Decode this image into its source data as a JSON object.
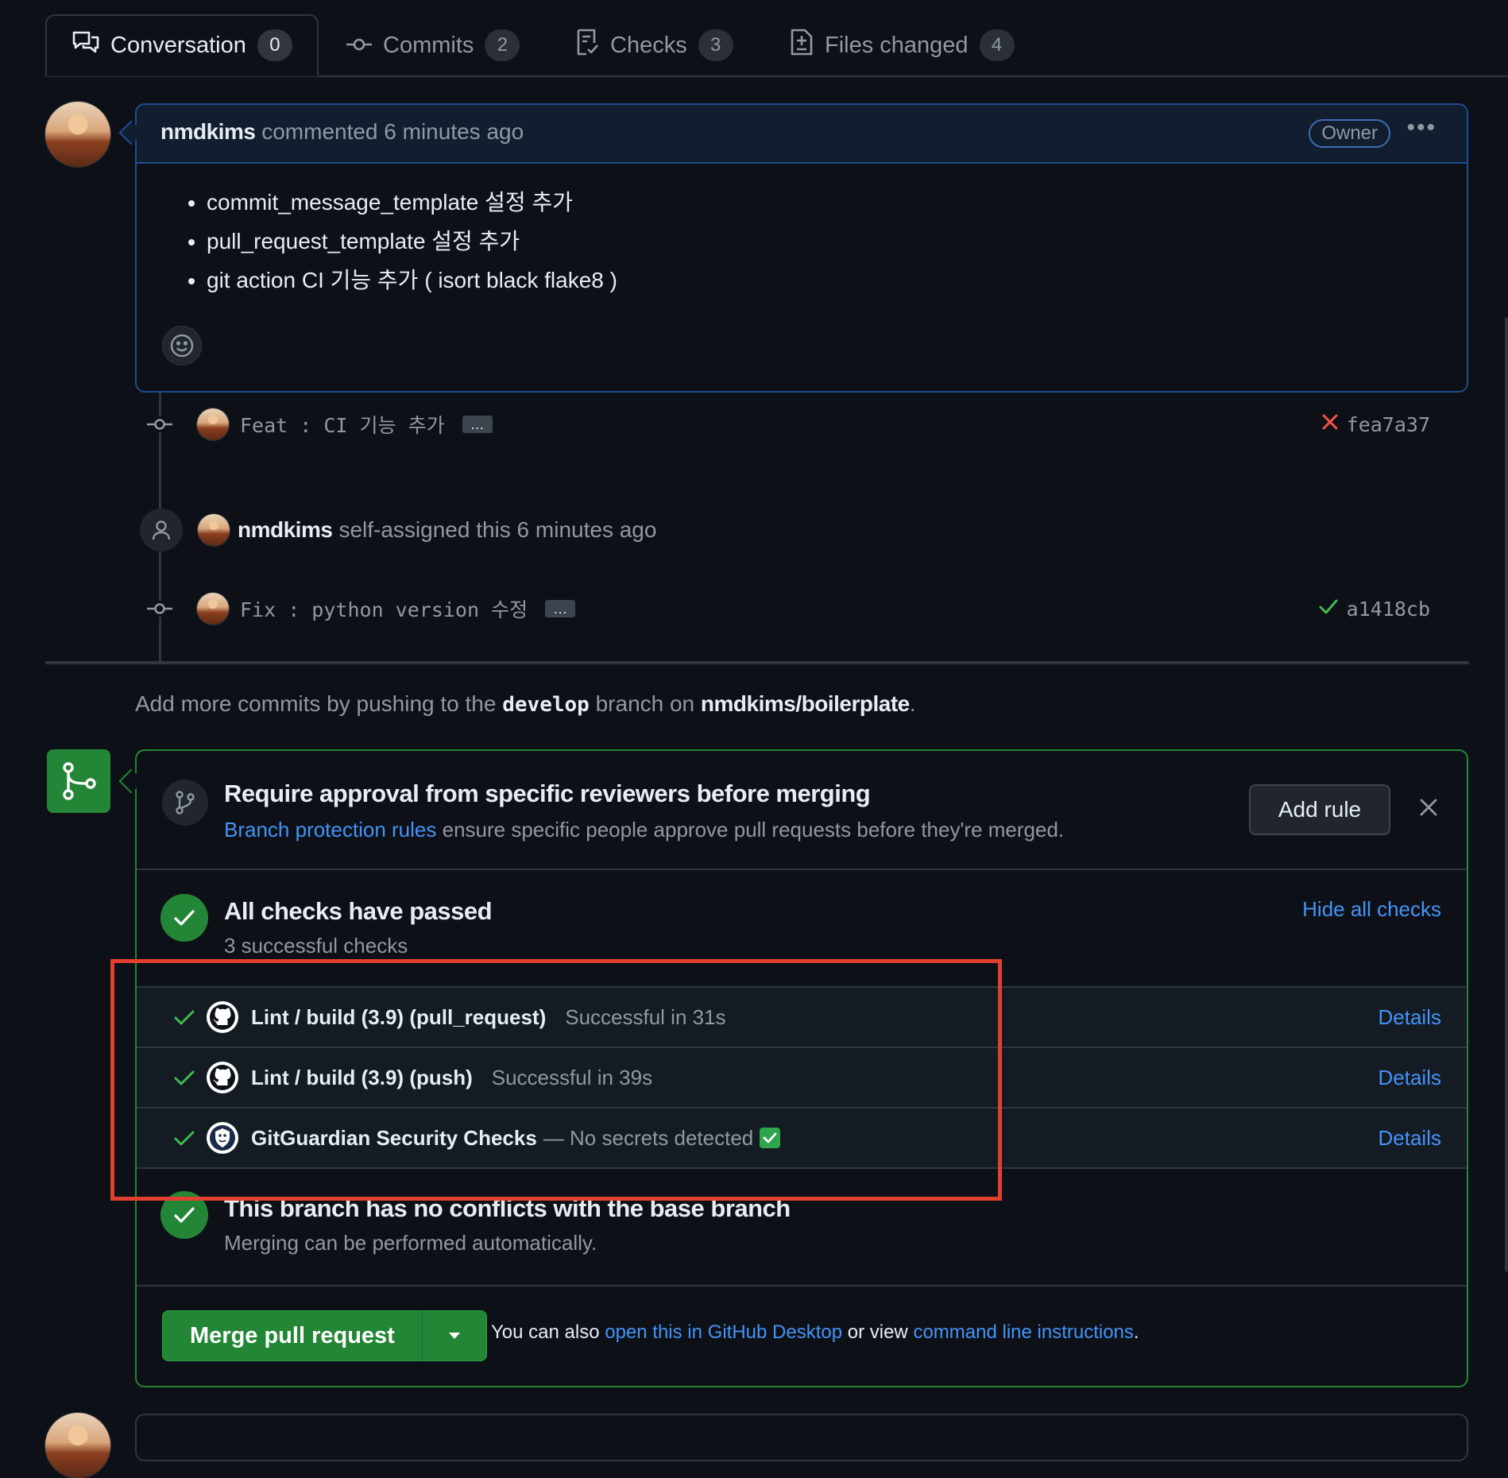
{
  "tabs": [
    {
      "label": "Conversation",
      "count": "0",
      "icon": "comment-discussion-icon"
    },
    {
      "label": "Commits",
      "count": "2",
      "icon": "git-commit-icon"
    },
    {
      "label": "Checks",
      "count": "3",
      "icon": "checklist-icon"
    },
    {
      "label": "Files changed",
      "count": "4",
      "icon": "file-diff-icon"
    }
  ],
  "comment": {
    "author": "nmdkims",
    "action": "commented 6 minutes ago",
    "badge": "Owner",
    "more_icon": "kebab-horizontal-icon",
    "items": [
      "commit_message_template 설정 추가",
      "pull_request_template 설정 추가",
      "git action CI 기능 추가 ( isort black flake8 )"
    ],
    "reaction_icon": "smiley-icon"
  },
  "timeline": {
    "commit1": {
      "message": "Feat : CI 기능 추가",
      "ellipsis": "…",
      "sha": "fea7a37",
      "status_icon": "x-icon",
      "status_color": "#f85149"
    },
    "assigned": {
      "user": "nmdkims",
      "text": "self-assigned this 6 minutes ago",
      "icon": "person-icon"
    },
    "commit2": {
      "message": "Fix : python version 수정",
      "ellipsis": "…",
      "sha": "a1418cb",
      "status_icon": "check-icon",
      "status_color": "#3fb950"
    }
  },
  "push_note": {
    "prefix": "Add more commits by pushing to the",
    "branch": "develop",
    "middle": "branch on",
    "repo": "nmdkims/boilerplate",
    "suffix": "."
  },
  "merge": {
    "rule": {
      "title": "Require approval from specific reviewers before merging",
      "link": "Branch protection rules",
      "text": "ensure specific people approve pull requests before they're merged.",
      "button": "Add rule",
      "close_icon": "x-icon"
    },
    "checks": {
      "title": "All checks have passed",
      "subtitle": "3 successful checks",
      "toggle": "Hide all checks",
      "items": [
        {
          "name": "Lint / build (3.9) (pull_request)",
          "status": "Successful in 31s",
          "details": "Details",
          "logo": "github-logo-icon"
        },
        {
          "name": "Lint / build (3.9) (push)",
          "status": "Successful in 39s",
          "details": "Details",
          "logo": "github-logo-icon"
        },
        {
          "name": "GitGuardian Security Checks",
          "status": "— No secrets detected",
          "emoji": "✅",
          "details": "Details",
          "logo": "gitguardian-logo-icon"
        }
      ]
    },
    "conflicts": {
      "title": "This branch has no conflicts with the base branch",
      "subtitle": "Merging can be performed automatically."
    },
    "button": "Merge pull request",
    "note": {
      "prefix": "You can also",
      "link1": "open this in GitHub Desktop",
      "middle": "or view",
      "link2": "command line instructions",
      "suffix": "."
    }
  },
  "colors": {
    "background": "#0d1117",
    "accent_blue": "#4493f8",
    "success_green": "#238636",
    "highlight_red": "#e0402e"
  }
}
